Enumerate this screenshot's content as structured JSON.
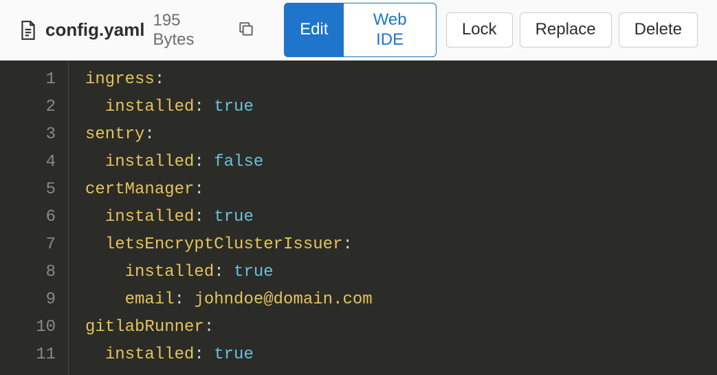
{
  "header": {
    "file_name": "config.yaml",
    "file_size": "195 Bytes",
    "edit_label": "Edit",
    "webide_label": "Web IDE",
    "lock_label": "Lock",
    "replace_label": "Replace",
    "delete_label": "Delete"
  },
  "code": {
    "lines": [
      {
        "n": "1",
        "tokens": [
          {
            "t": "key",
            "v": "ingress"
          },
          {
            "t": "colon",
            "v": ":"
          }
        ]
      },
      {
        "n": "2",
        "tokens": [
          {
            "t": "plain",
            "v": "  "
          },
          {
            "t": "key",
            "v": "installed"
          },
          {
            "t": "colon",
            "v": ": "
          },
          {
            "t": "bool",
            "v": "true"
          }
        ]
      },
      {
        "n": "3",
        "tokens": [
          {
            "t": "key",
            "v": "sentry"
          },
          {
            "t": "colon",
            "v": ":"
          }
        ]
      },
      {
        "n": "4",
        "tokens": [
          {
            "t": "plain",
            "v": "  "
          },
          {
            "t": "key",
            "v": "installed"
          },
          {
            "t": "colon",
            "v": ": "
          },
          {
            "t": "bool",
            "v": "false"
          }
        ]
      },
      {
        "n": "5",
        "tokens": [
          {
            "t": "key",
            "v": "certManager"
          },
          {
            "t": "colon",
            "v": ":"
          }
        ]
      },
      {
        "n": "6",
        "tokens": [
          {
            "t": "plain",
            "v": "  "
          },
          {
            "t": "key",
            "v": "installed"
          },
          {
            "t": "colon",
            "v": ": "
          },
          {
            "t": "bool",
            "v": "true"
          }
        ]
      },
      {
        "n": "7",
        "tokens": [
          {
            "t": "plain",
            "v": "  "
          },
          {
            "t": "key",
            "v": "letsEncryptClusterIssuer"
          },
          {
            "t": "colon",
            "v": ":"
          }
        ]
      },
      {
        "n": "8",
        "tokens": [
          {
            "t": "plain",
            "v": "    "
          },
          {
            "t": "key",
            "v": "installed"
          },
          {
            "t": "colon",
            "v": ": "
          },
          {
            "t": "bool",
            "v": "true"
          }
        ]
      },
      {
        "n": "9",
        "tokens": [
          {
            "t": "plain",
            "v": "    "
          },
          {
            "t": "key",
            "v": "email"
          },
          {
            "t": "colon",
            "v": ": "
          },
          {
            "t": "str",
            "v": "johndoe@domain.com"
          }
        ]
      },
      {
        "n": "10",
        "tokens": [
          {
            "t": "key",
            "v": "gitlabRunner"
          },
          {
            "t": "colon",
            "v": ":"
          }
        ]
      },
      {
        "n": "11",
        "tokens": [
          {
            "t": "plain",
            "v": "  "
          },
          {
            "t": "key",
            "v": "installed"
          },
          {
            "t": "colon",
            "v": ": "
          },
          {
            "t": "bool",
            "v": "true"
          }
        ]
      }
    ]
  }
}
